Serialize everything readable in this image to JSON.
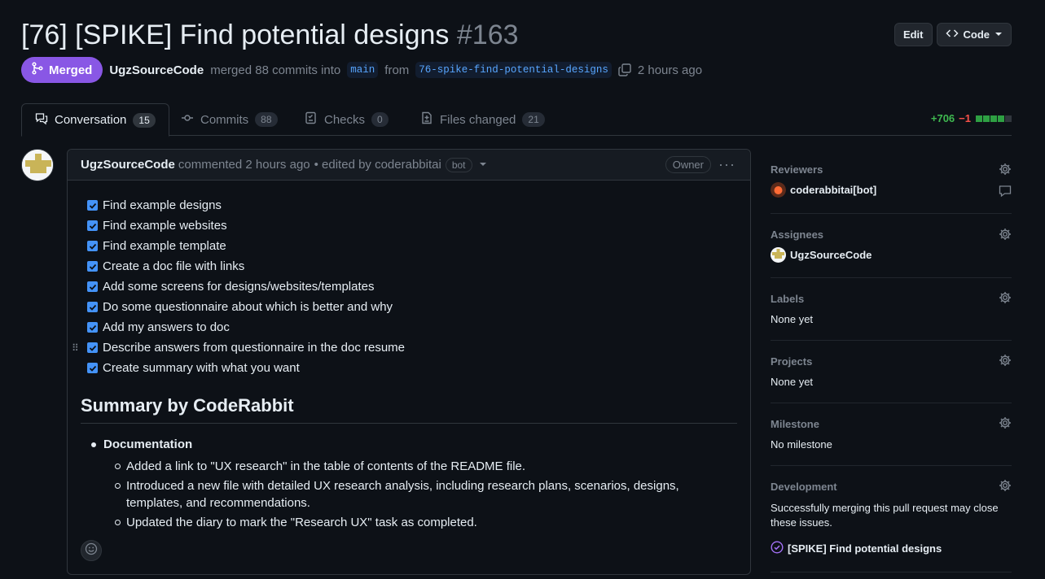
{
  "pr": {
    "title_text": "[76] [SPIKE] Find potential designs",
    "number": "#163",
    "edit_label": "Edit",
    "code_label": "Code",
    "status": "Merged",
    "author": "UgzSourceCode",
    "merged_text": "merged 88 commits into",
    "base_branch": "main",
    "from_text": "from",
    "head_branch": "76-spike-find-potential-designs",
    "time": "2 hours ago"
  },
  "tabs": [
    {
      "label": "Conversation",
      "count": "15",
      "icon": "comment-discussion-icon"
    },
    {
      "label": "Commits",
      "count": "88",
      "icon": "git-commit-icon"
    },
    {
      "label": "Checks",
      "count": "0",
      "icon": "checklist-icon"
    },
    {
      "label": "Files changed",
      "count": "21",
      "icon": "file-diff-icon"
    }
  ],
  "diffstat": {
    "additions": "+706",
    "deletions": "−1"
  },
  "comment": {
    "author": "UgzSourceCode",
    "commented_text": "commented 2 hours ago",
    "edited_text": "• edited by coderabbitai",
    "bot_label": "bot",
    "owner_label": "Owner",
    "tasks": [
      "Find example designs",
      "Find example websites",
      "Find example template",
      "Create a doc file with links",
      "Add some screens for designs/websites/templates",
      "Do some questionnaire about which is better and why",
      "Add my answers to doc",
      "Describe answers from questionnaire in the doc resume",
      "Create summary with what you want"
    ],
    "summary_title": "Summary by CodeRabbit",
    "doc_heading": "Documentation",
    "doc_items": [
      "Added a link to \"UX research\" in the table of contents of the README file.",
      "Introduced a new file with detailed UX research analysis, including research plans, scenarios, designs, templates, and recommendations.",
      "Updated the diary to mark the \"Research UX\" task as completed."
    ]
  },
  "sidebar": {
    "reviewers_label": "Reviewers",
    "reviewer_name": "coderabbitai[bot]",
    "assignees_label": "Assignees",
    "assignee_name": "UgzSourceCode",
    "labels_label": "Labels",
    "labels_value": "None yet",
    "projects_label": "Projects",
    "projects_value": "None yet",
    "milestone_label": "Milestone",
    "milestone_value": "No milestone",
    "development_label": "Development",
    "development_text": "Successfully merging this pull request may close these issues.",
    "linked_issue": "[SPIKE] Find potential designs"
  },
  "colors": {
    "merged": "#8957e5",
    "link": "#58a6ff",
    "additions": "#3fb950",
    "deletions": "#f85149"
  }
}
